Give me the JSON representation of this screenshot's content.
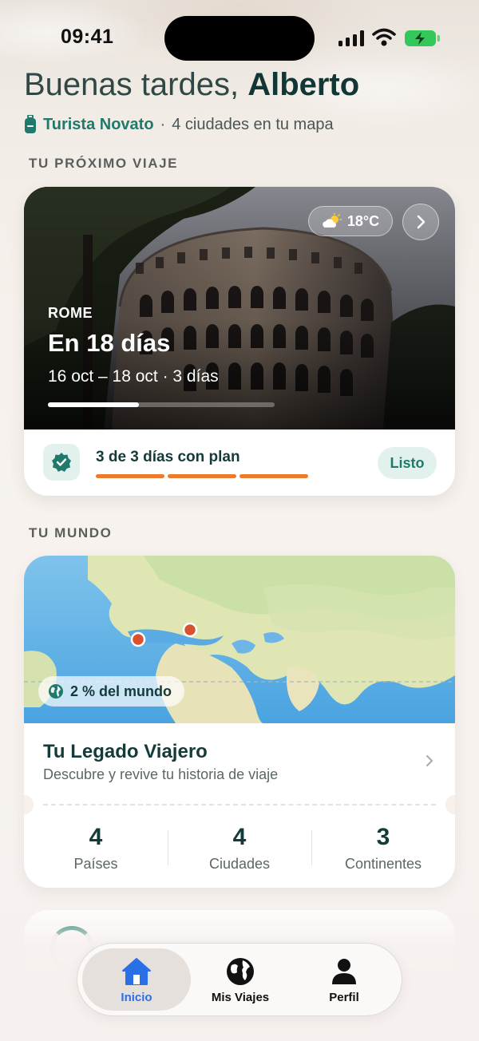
{
  "status_bar": {
    "time": "09:41"
  },
  "header": {
    "greeting": "Buenas tardes,",
    "name": "Alberto",
    "rank": "Turista Novato",
    "separator": "·",
    "cities_summary": "4 ciudades en tu mapa"
  },
  "next_trip": {
    "section_label": "TU PRÓXIMO VIAJE",
    "weather": {
      "icon": "partly-cloudy-icon",
      "temperature": "18°C"
    },
    "city": "ROME",
    "countdown": "En 18 días",
    "dates": "16 oct – 18 oct · 3 días",
    "progress": 0.4,
    "plan_status": "3 de 3 días con plan",
    "plan_bars_filled": 3,
    "ready_label": "Listo"
  },
  "world": {
    "section_label": "TU MUNDO",
    "percent_label": "2 % del mundo",
    "legacy_title": "Tu Legado Viajero",
    "legacy_subtitle": "Descubre y revive tu historia de viaje",
    "stats": [
      {
        "value": "4",
        "label": "Países"
      },
      {
        "value": "4",
        "label": "Ciudades"
      },
      {
        "value": "3",
        "label": "Continentes"
      }
    ]
  },
  "tab_bar": {
    "tabs": [
      {
        "label": "Inicio",
        "icon": "home-icon",
        "active": true
      },
      {
        "label": "Mis Viajes",
        "icon": "globe-icon",
        "active": false
      },
      {
        "label": "Perfil",
        "icon": "person-icon",
        "active": false
      }
    ]
  },
  "colors": {
    "brand_teal": "#1f7a6c",
    "accent_orange": "#ee7b2c",
    "active_tab_blue": "#2b6fe6",
    "map_pin": "#d9512e"
  }
}
